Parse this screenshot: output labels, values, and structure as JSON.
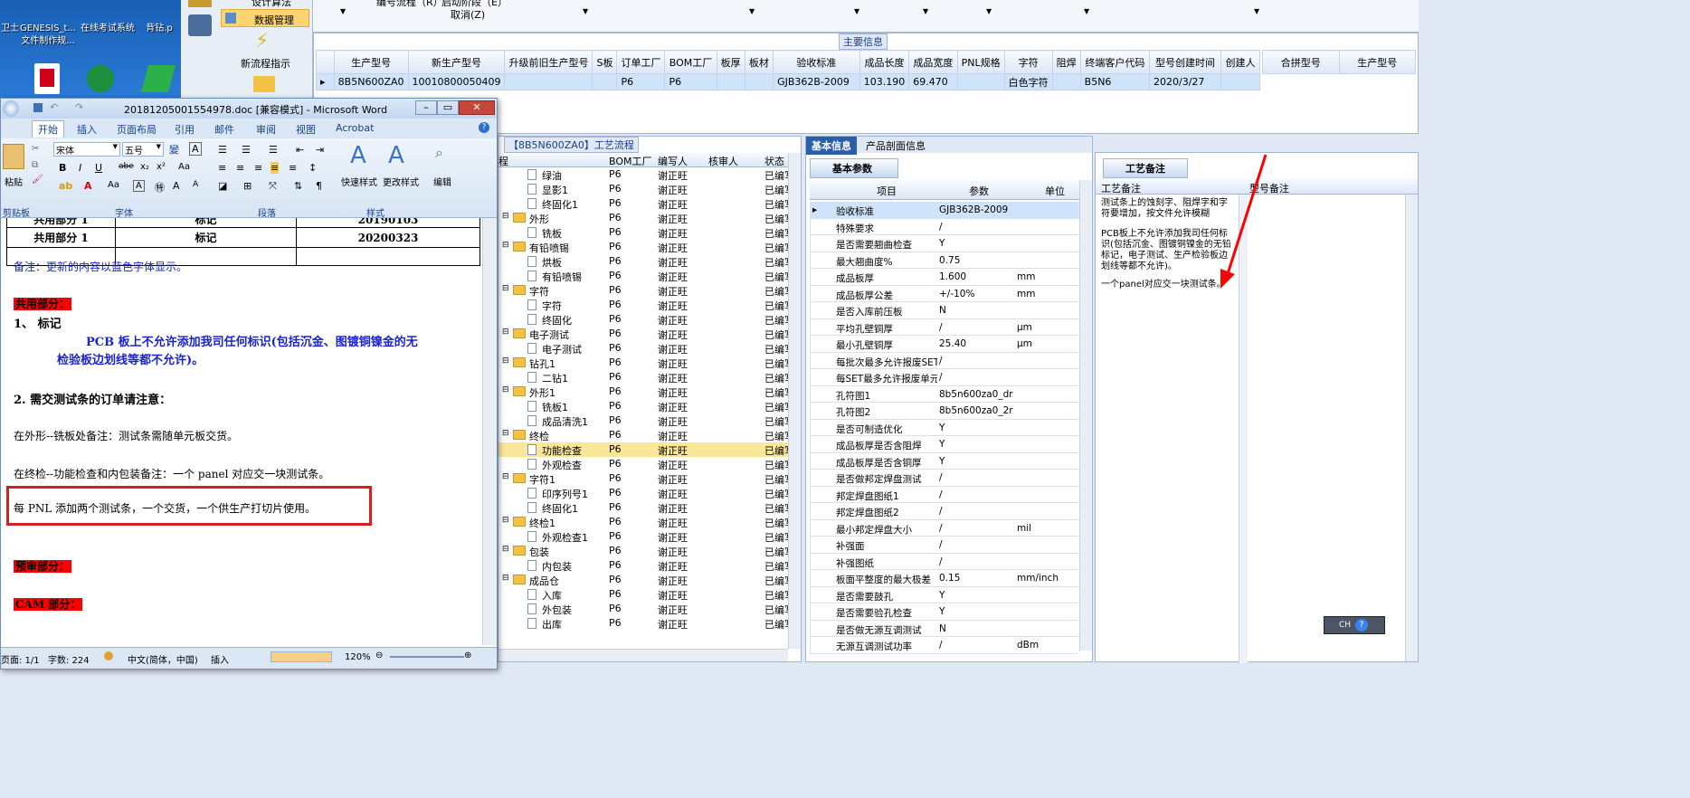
{
  "desktop": {
    "icons": [
      "卫士",
      "GENESIS_t...",
      "在线考试系统",
      "背钻.p",
      "文件制作规..."
    ]
  },
  "launcher": {
    "items": [
      "设计算法",
      "数据管理",
      "新流程指示"
    ]
  },
  "toolbar": {
    "row1": [
      "编号流程（R）",
      "启动阶段（E）"
    ],
    "cancel": "取消(Z)"
  },
  "main_info": {
    "section_title": "主要信息",
    "columns": [
      "生产型号",
      "新生产型号",
      "升级前旧生产型号",
      "S板",
      "订单工厂",
      "BOM工厂",
      "板厚",
      "板材",
      "验收标准",
      "成品长度",
      "成品宽度",
      "PNL规格",
      "字符",
      "阻焊",
      "终端客户代码",
      "型号创建时间",
      "创建人"
    ],
    "row": [
      "8B5N600ZA0",
      "10010800050409",
      "",
      "",
      "P6",
      "P6",
      "",
      "",
      "GJB362B-2009",
      "103.190",
      "69.470",
      "",
      "白色字符",
      "",
      "B5N6",
      "2020/3/27",
      ""
    ],
    "side_columns": [
      "合拼型号",
      "生产型号"
    ]
  },
  "word": {
    "title": "20181205001554978.doc [兼容模式] - Microsoft Word",
    "tabs": [
      "开始",
      "插入",
      "页面布局",
      "引用",
      "邮件",
      "审阅",
      "视图",
      "Acrobat"
    ],
    "font_name": "宋体",
    "font_size": "五号",
    "ribbon_labels": {
      "paste": "粘贴",
      "quick_style": "快速样式",
      "change_style": "更改样式",
      "edit": "编辑",
      "clipboard": "剪贴板",
      "font": "字体",
      "paragraph": "段落",
      "styles": "样式"
    },
    "table_rows": [
      [
        "共用部分 1",
        "标记",
        "20190103"
      ],
      [
        "共用部分 1",
        "标记",
        "20200323"
      ]
    ],
    "paragraphs": {
      "note": "备注：更新的内容以蓝色字体显示。",
      "common_heading": "共用部分：",
      "item1": "1、 标记",
      "item1_text_a": "PCB 板上不允许添加我司任何标识(包括沉金、图镀铜镍金的无",
      "item1_text_b": "检验板边划线等都不允许)。",
      "item2": "2.   需交测试条的订单请注意：",
      "line_a": "在外形--铣板处备注：测试条需随单元板交货。",
      "line_b": "在终检--功能检查和内包装备注：一个 panel 对应交一块测试条。",
      "line_c": "每 PNL 添加两个测试条，一个交货，一个供生产打切片使用。",
      "pre_review": "预审部分：",
      "cam": "CAM 部分："
    },
    "status": {
      "page": "页面: 1/1",
      "words": "字数: 224",
      "lang": "中文(简体，中国)",
      "insert": "插入",
      "zoom": "120%"
    }
  },
  "tree": {
    "title": "【8B5N600ZA0】工艺流程",
    "columns": [
      "程",
      "BOM工厂",
      "编写人",
      "核审人",
      "状态"
    ],
    "rows": [
      {
        "level": 1,
        "name": "绿油",
        "bom": "P6",
        "writer": "谢正旺",
        "status": "已编写"
      },
      {
        "level": 1,
        "name": "显影1",
        "bom": "P6",
        "writer": "谢正旺",
        "status": "已编写"
      },
      {
        "level": 1,
        "name": "终固化1",
        "bom": "P6",
        "writer": "谢正旺",
        "status": "已编写"
      },
      {
        "level": 0,
        "name": "外形",
        "bom": "P6",
        "writer": "谢正旺",
        "status": "已编写"
      },
      {
        "level": 1,
        "name": "铣板",
        "bom": "P6",
        "writer": "谢正旺",
        "status": "已编写"
      },
      {
        "level": 0,
        "name": "有铅喷锡",
        "bom": "P6",
        "writer": "谢正旺",
        "status": "已编写"
      },
      {
        "level": 1,
        "name": "烘板",
        "bom": "P6",
        "writer": "谢正旺",
        "status": "已编写"
      },
      {
        "level": 1,
        "name": "有铅喷锡",
        "bom": "P6",
        "writer": "谢正旺",
        "status": "已编写"
      },
      {
        "level": 0,
        "name": "字符",
        "bom": "P6",
        "writer": "谢正旺",
        "status": "已编写"
      },
      {
        "level": 1,
        "name": "字符",
        "bom": "P6",
        "writer": "谢正旺",
        "status": "已编写"
      },
      {
        "level": 1,
        "name": "终固化",
        "bom": "P6",
        "writer": "谢正旺",
        "status": "已编写"
      },
      {
        "level": 0,
        "name": "电子测试",
        "bom": "P6",
        "writer": "谢正旺",
        "status": "已编写"
      },
      {
        "level": 1,
        "name": "电子测试",
        "bom": "P6",
        "writer": "谢正旺",
        "status": "已编写"
      },
      {
        "level": 0,
        "name": "钻孔1",
        "bom": "P6",
        "writer": "谢正旺",
        "status": "已编写"
      },
      {
        "level": 1,
        "name": "二钻1",
        "bom": "P6",
        "writer": "谢正旺",
        "status": "已编写"
      },
      {
        "level": 0,
        "name": "外形1",
        "bom": "P6",
        "writer": "谢正旺",
        "status": "已编写"
      },
      {
        "level": 1,
        "name": "铣板1",
        "bom": "P6",
        "writer": "谢正旺",
        "status": "已编写"
      },
      {
        "level": 1,
        "name": "成品清洗1",
        "bom": "P6",
        "writer": "谢正旺",
        "status": "已编写"
      },
      {
        "level": 0,
        "name": "终检",
        "bom": "P6",
        "writer": "谢正旺",
        "status": "已编写"
      },
      {
        "level": 1,
        "name": "功能检查",
        "bom": "P6",
        "writer": "谢正旺",
        "status": "已编写",
        "selected": true
      },
      {
        "level": 1,
        "name": "外观检查",
        "bom": "P6",
        "writer": "谢正旺",
        "status": "已编写"
      },
      {
        "level": 0,
        "name": "字符1",
        "bom": "P6",
        "writer": "谢正旺",
        "status": "已编写"
      },
      {
        "level": 1,
        "name": "印序列号1",
        "bom": "P6",
        "writer": "谢正旺",
        "status": "已编写"
      },
      {
        "level": 1,
        "name": "终固化1",
        "bom": "P6",
        "writer": "谢正旺",
        "status": "已编写"
      },
      {
        "level": 0,
        "name": "终检1",
        "bom": "P6",
        "writer": "谢正旺",
        "status": "已编写"
      },
      {
        "level": 1,
        "name": "外观检查1",
        "bom": "P6",
        "writer": "谢正旺",
        "status": "已编写"
      },
      {
        "level": 0,
        "name": "包装",
        "bom": "P6",
        "writer": "谢正旺",
        "status": "已编写"
      },
      {
        "level": 1,
        "name": "内包装",
        "bom": "P6",
        "writer": "谢正旺",
        "status": "已编写"
      },
      {
        "level": 0,
        "name": "成品仓",
        "bom": "P6",
        "writer": "谢正旺",
        "status": "已编写"
      },
      {
        "level": 1,
        "name": "入库",
        "bom": "P6",
        "writer": "谢正旺",
        "status": "已编写"
      },
      {
        "level": 1,
        "name": "外包装",
        "bom": "P6",
        "writer": "谢正旺",
        "status": "已编写"
      },
      {
        "level": 1,
        "name": "出库",
        "bom": "P6",
        "writer": "谢正旺",
        "status": "已编写"
      }
    ]
  },
  "basic": {
    "tabs": [
      "基本信息",
      "产品剖面信息"
    ],
    "subtab": "基本参数",
    "columns": [
      "项目",
      "参数",
      "单位"
    ],
    "rows": [
      [
        "验收标准",
        "GJB362B-2009",
        ""
      ],
      [
        "特殊要求",
        "/",
        ""
      ],
      [
        "是否需要翘曲检查",
        "Y",
        ""
      ],
      [
        "最大翘曲度%",
        "0.75",
        ""
      ],
      [
        "成品板厚",
        "1.600",
        "mm"
      ],
      [
        "成品板厚公差",
        "+/-10%",
        "mm"
      ],
      [
        "是否入库前压板",
        "N",
        ""
      ],
      [
        "平均孔壁铜厚",
        "/",
        "μm"
      ],
      [
        "最小孔壁铜厚",
        "25.40",
        "μm"
      ],
      [
        "每批次最多允许报废SET",
        "/",
        ""
      ],
      [
        "每SET最多允许报废单元",
        "/",
        ""
      ],
      [
        "孔符图1",
        "8b5n600za0_dr...",
        ""
      ],
      [
        "孔符图2",
        "8b5n600za0_2r...",
        ""
      ],
      [
        "是否可制造优化",
        "Y",
        ""
      ],
      [
        "成品板厚是否含阻焊",
        "Y",
        ""
      ],
      [
        "成品板厚是否含铜厚",
        "Y",
        ""
      ],
      [
        "是否做邦定焊盘测试",
        "/",
        ""
      ],
      [
        "邦定焊盘图纸1",
        "/",
        ""
      ],
      [
        "邦定焊盘图纸2",
        "/",
        ""
      ],
      [
        "最小邦定焊盘大小",
        "/",
        "mil"
      ],
      [
        "补强面",
        "/",
        ""
      ],
      [
        "补强图纸",
        "/",
        ""
      ],
      [
        "板面平整度的最大极差",
        "0.15",
        "mm/inch"
      ],
      [
        "是否需要鼓孔",
        "Y",
        ""
      ],
      [
        "是否需要验孔检查",
        "Y",
        ""
      ],
      [
        "是否做无源互调测试",
        "N",
        ""
      ],
      [
        "无源互调测试功率",
        "/",
        "dBm"
      ]
    ]
  },
  "notes": {
    "tab": "工艺备注",
    "col1": "工艺备注",
    "col2": "型号备注",
    "text1": "测试条上的蚀刻字、阻焊字和字符要增加，按文件允许模糊",
    "text2": "PCB板上不允许添加我司任何标识(包括沉金、图镀铜镍金的无铅标记，电子测试、生产检验板边划线等都不允许)。",
    "text3": "一个panel对应交一块测试条。"
  },
  "ime": {
    "label": "CH"
  }
}
